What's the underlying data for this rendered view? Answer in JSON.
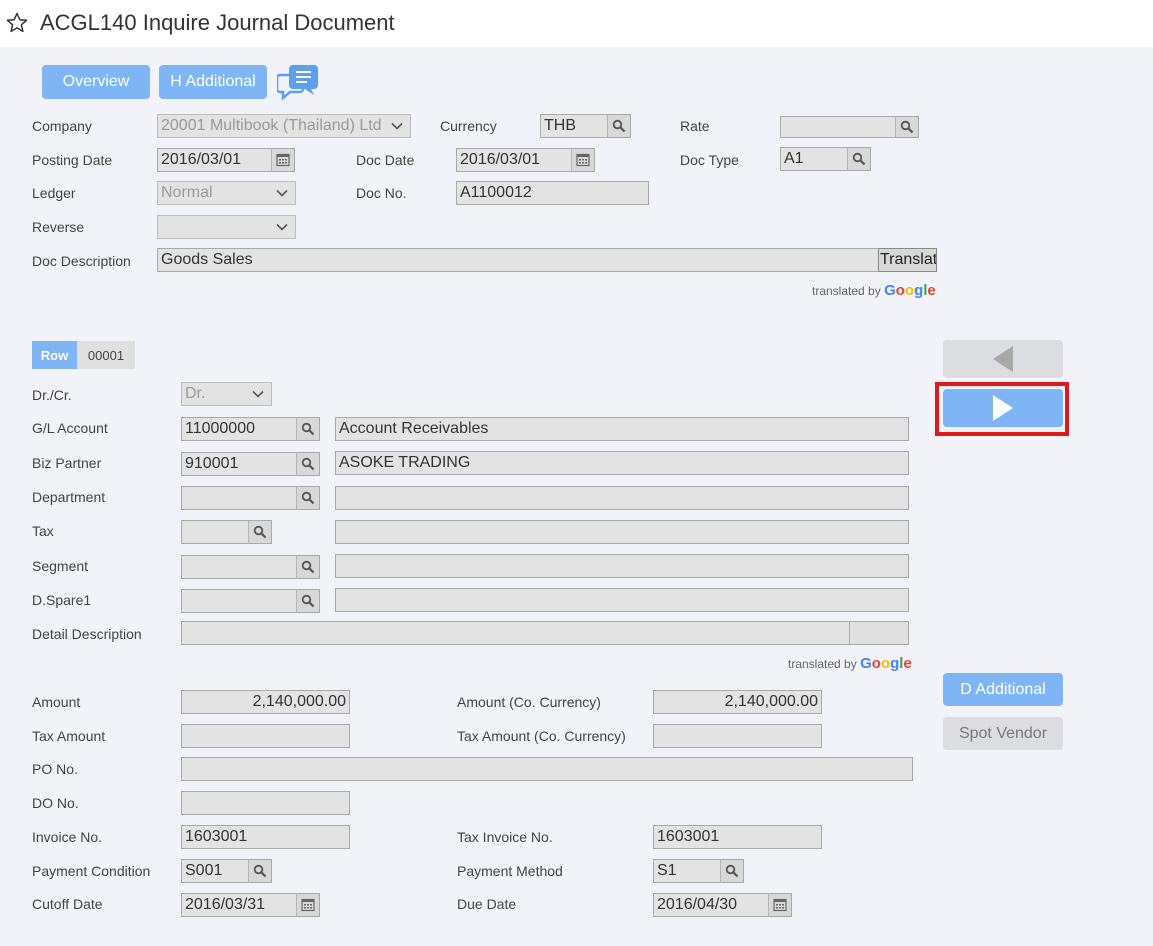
{
  "header": {
    "title": "ACGL140 Inquire Journal Document"
  },
  "toolbar": {
    "overview_label": "Overview",
    "h_additional_label": "H Additional"
  },
  "header_form": {
    "company": {
      "label": "Company",
      "value": "20001 Multibook (Thailand) Ltd"
    },
    "currency": {
      "label": "Currency",
      "value": "THB"
    },
    "rate": {
      "label": "Rate",
      "value": ""
    },
    "posting_date": {
      "label": "Posting Date",
      "value": "2016/03/01"
    },
    "doc_date": {
      "label": "Doc Date",
      "value": "2016/03/01"
    },
    "doc_type": {
      "label": "Doc Type",
      "value": "A1"
    },
    "ledger": {
      "label": "Ledger",
      "value": "Normal"
    },
    "doc_no": {
      "label": "Doc No.",
      "value": "A1100012"
    },
    "reverse": {
      "label": "Reverse",
      "value": ""
    },
    "doc_description": {
      "label": "Doc Description",
      "value": "Goods Sales",
      "translate_label": "Translat"
    },
    "translated_by": "translated by",
    "google": "Google"
  },
  "detail": {
    "row_label": "Row",
    "row_number": "00001",
    "dr_cr": {
      "label": "Dr./Cr.",
      "value": "Dr."
    },
    "gl_account": {
      "label": "G/L Account",
      "code": "11000000",
      "name": "Account Receivables"
    },
    "biz_partner": {
      "label": "Biz Partner",
      "code": "910001",
      "name": "ASOKE TRADING"
    },
    "department": {
      "label": "Department",
      "code": "",
      "name": ""
    },
    "tax": {
      "label": "Tax",
      "code": "",
      "name": ""
    },
    "segment": {
      "label": "Segment",
      "code": "",
      "name": ""
    },
    "d_spare1": {
      "label": "D.Spare1",
      "code": "",
      "name": ""
    },
    "detail_description": {
      "label": "Detail Description",
      "value": ""
    },
    "translated_by": "translated by",
    "google": "Google"
  },
  "amounts": {
    "amount": {
      "label": "Amount",
      "value": "2,140,000.00"
    },
    "amount_co": {
      "label": "Amount (Co. Currency)",
      "value": "2,140,000.00"
    },
    "tax_amount": {
      "label": "Tax Amount",
      "value": ""
    },
    "tax_amount_co": {
      "label": "Tax Amount (Co. Currency)",
      "value": ""
    },
    "po_no": {
      "label": "PO No.",
      "value": ""
    },
    "do_no": {
      "label": "DO No.",
      "value": ""
    },
    "invoice_no": {
      "label": "Invoice No.",
      "value": "1603001"
    },
    "tax_invoice_no": {
      "label": "Tax Invoice No.",
      "value": "1603001"
    },
    "payment_condition": {
      "label": "Payment Condition",
      "value": "S001"
    },
    "payment_method": {
      "label": "Payment Method",
      "value": "S1"
    },
    "cutoff_date": {
      "label": "Cutoff Date",
      "value": "2016/03/31"
    },
    "due_date": {
      "label": "Due Date",
      "value": "2016/04/30"
    }
  },
  "side_buttons": {
    "d_additional_label": "D Additional",
    "spot_vendor_label": "Spot Vendor"
  },
  "colors": {
    "accent": "#7fb4f5",
    "highlight": "#e01a1a",
    "google_blue": "#4285F4",
    "google_red": "#EA4335",
    "google_yellow": "#FBBC05",
    "google_green": "#34A853"
  }
}
